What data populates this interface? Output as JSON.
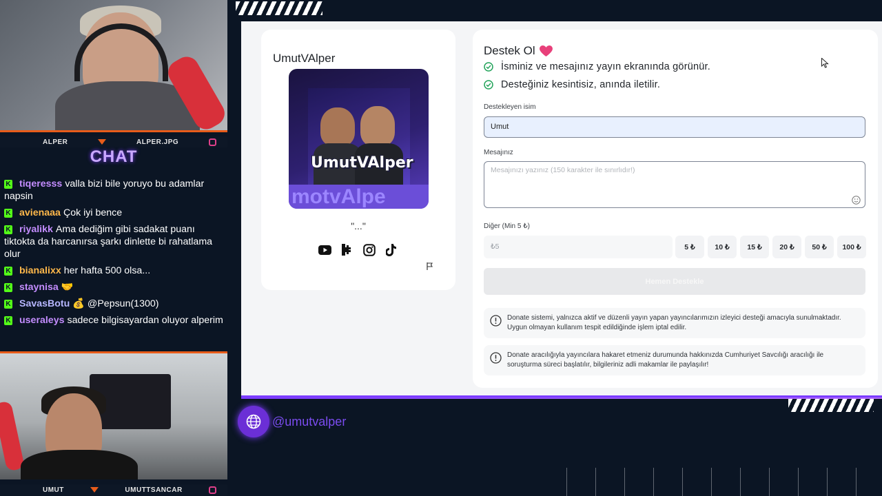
{
  "overlay": {
    "cam_top": {
      "left_label": "ALPER",
      "right_label": "ALPER.JPG"
    },
    "cam_bottom": {
      "left_label": "UMUT",
      "right_label": "UMUTTSANCAR"
    },
    "chat_title": "CHAT",
    "chat": [
      {
        "user": "tiqeresss",
        "color": "#c48dff",
        "text": "valla bizi bile yoruyo bu adamlar napsin"
      },
      {
        "user": "avienaaa",
        "color": "#ffb84a",
        "text": "Çok iyi bence"
      },
      {
        "user": "riyalikk",
        "color": "#c48dff",
        "text": "Ama dediğim gibi sadakat puanı tiktokta da harcanırsa şarkı dinlette bi rahatlama olur"
      },
      {
        "user": "bianalixx",
        "color": "#ffb84a",
        "text": "her hafta 500 olsa..."
      },
      {
        "user": "staynisa",
        "color": "#c48dff",
        "text": "🤝"
      },
      {
        "user": "SavasBotu",
        "color": "#b7b7ff",
        "text": "💰 @Pepsun(1300)"
      },
      {
        "user": "useraleys",
        "color": "#c48dff",
        "text": "sadece bilgisayardan oluyor alperim"
      }
    ],
    "handle": "@umutvalper"
  },
  "profile": {
    "name": "UmutVAlper",
    "avatar_text": "UmutVAlper",
    "avatar_band_text": "motvAlpe",
    "quote": "\"...\"",
    "socials": [
      "youtube-icon",
      "kick-icon",
      "instagram-icon",
      "tiktok-icon"
    ]
  },
  "form": {
    "title": "Destek Ol",
    "checks": [
      "İsminiz ve mesajınız yayın ekranında görünür.",
      "Desteğiniz kesintisiz, anında iletilir."
    ],
    "name_label": "Destekleyen isim",
    "name_value": "Umut",
    "message_label": "Mesajınız",
    "message_placeholder": "Mesajınızı yazınız (150 karakter ile sınırlıdır!)",
    "other_label": "Diğer (Min 5 ₺)",
    "amount_placeholder": "₺5",
    "amounts": [
      "5 ₺",
      "10 ₺",
      "15 ₺",
      "20 ₺",
      "50 ₺",
      "100 ₺"
    ],
    "submit_label": "Hemen Destekle",
    "notices": [
      "Donate sistemi, yalnızca aktif ve düzenli yayın yapan yayıncılarımızın izleyici desteği amacıyla sunulmaktadır. Uygun olmayan kullanım tespit edildiğinde işlem iptal edilir.",
      "Donate aracılığıyla yayıncılara hakaret etmeniz durumunda hakkınızda Cumhuriyet Savcılığı aracılığı ile soruşturma süreci başlatılır, bilgileriniz adli makamlar ile paylaşılır!"
    ]
  },
  "colors": {
    "accent": "#7b3cff",
    "kick_green": "#53fc18",
    "heart": "#e8407a",
    "check_green": "#22a35a"
  }
}
